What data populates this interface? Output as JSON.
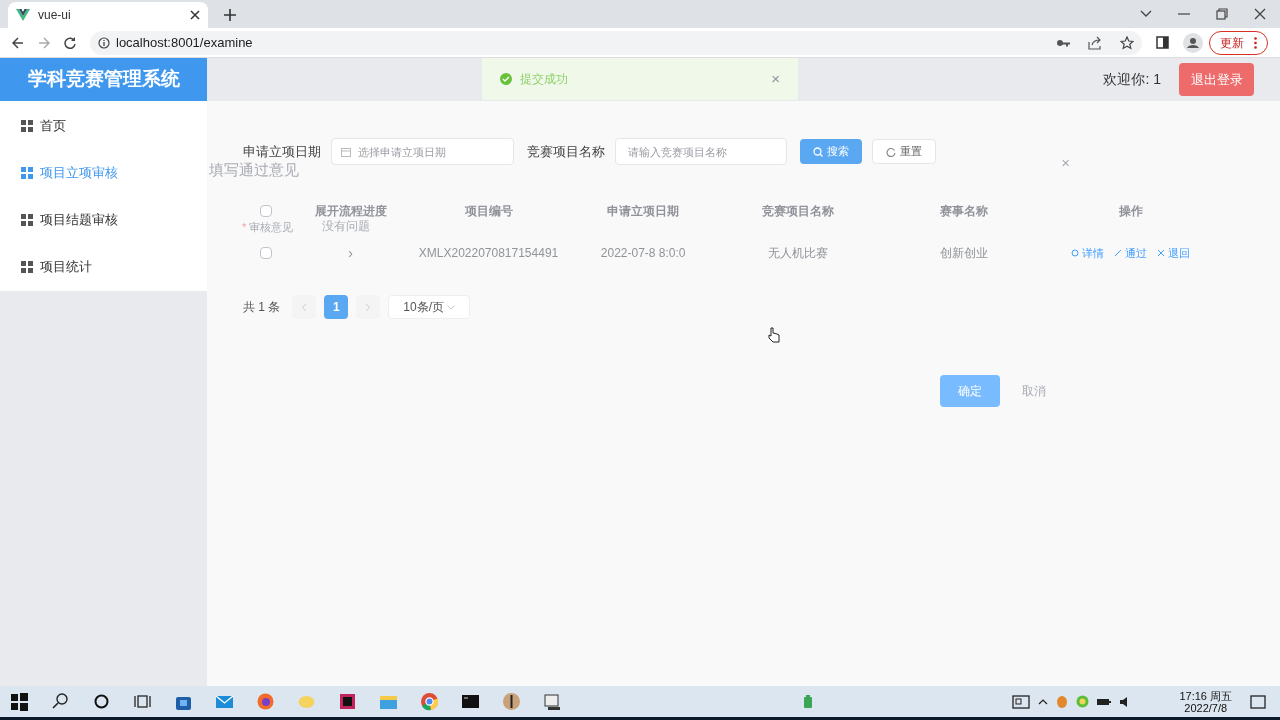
{
  "browser": {
    "tab_title": "vue-ui",
    "url": "localhost:8001/examine",
    "update_button": "更新"
  },
  "header": {
    "app_title": "学科竞赛管理系统",
    "welcome": "欢迎你: 1",
    "logout_button": "退出登录"
  },
  "toast": {
    "message": "提交成功",
    "close": "×"
  },
  "sidebar": {
    "items": [
      {
        "label": "首页",
        "selected": false
      },
      {
        "label": "项目立项审核",
        "selected": true
      },
      {
        "label": "项目结题审核",
        "selected": false
      },
      {
        "label": "项目统计",
        "selected": false
      }
    ]
  },
  "search": {
    "fields": [
      {
        "label": "申请立项日期",
        "placeholder": "选择申请立项日期",
        "kind": "date"
      },
      {
        "label": "竞赛项目名称",
        "placeholder": "请输入竞赛项目名称",
        "kind": "text"
      }
    ],
    "search_button": "搜索",
    "reset_button": "重置"
  },
  "table": {
    "all_checked": false,
    "columns": [
      "展开流程进度",
      "项目编号",
      "申请立项日期",
      "竞赛项目名称",
      "赛事名称",
      "操作"
    ],
    "rows": [
      {
        "checked": false,
        "cells": [
          "›",
          "XMLX2022070817154491",
          "2022-07-8 8:0:0",
          "无人机比赛",
          "创新创业"
        ],
        "actions": [
          {
            "label": "详情",
            "kind": "detail"
          },
          {
            "label": "通过",
            "kind": "approve"
          },
          {
            "label": "退回",
            "kind": "reject"
          }
        ]
      }
    ]
  },
  "pagination": {
    "total": "共 1 条",
    "pages": [
      {
        "label": "1",
        "selected": true
      }
    ],
    "page_size": "10条/页"
  },
  "dialog": {
    "title": "填写通过意见",
    "close": "×",
    "required_mark": "*",
    "field_label": "审核意见",
    "value": "没有问题",
    "confirm_button": "确定",
    "cancel_button": "取消"
  },
  "taskbar": {
    "time": "17:16 周五",
    "date": "2022/7/8"
  }
}
